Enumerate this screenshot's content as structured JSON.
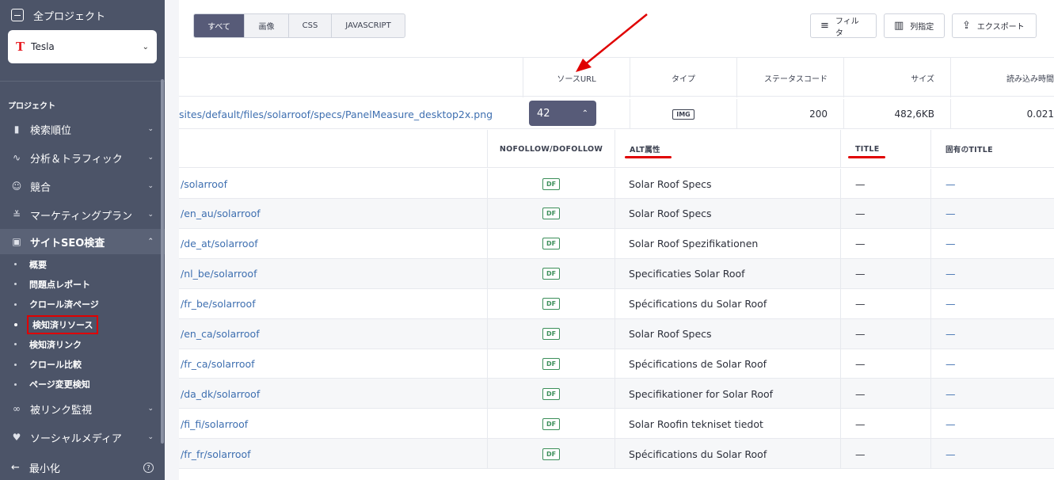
{
  "sidebar": {
    "all_projects": "全プロジェクト",
    "project_name": "Tesla",
    "project_logo": "T",
    "section_label": "プロジェクト",
    "nav": [
      {
        "label": "検索順位",
        "icon": "bar-chart-icon"
      },
      {
        "label": "分析＆トラフィック",
        "icon": "pulse-icon"
      },
      {
        "label": "競合",
        "icon": "users-icon"
      },
      {
        "label": "マーケティングプラン",
        "icon": "checklist-icon"
      },
      {
        "label": "サイトSEO検査",
        "icon": "search-doc-icon"
      }
    ],
    "sub": [
      {
        "label": "概要"
      },
      {
        "label": "問題点レポート"
      },
      {
        "label": "クロール済ページ"
      },
      {
        "label": "検知済リソース"
      },
      {
        "label": "検知済リンク"
      },
      {
        "label": "クロール比較"
      },
      {
        "label": "ページ変更検知"
      }
    ],
    "nav2": [
      {
        "label": "被リンク監視",
        "icon": "link-icon"
      },
      {
        "label": "ソーシャルメディア",
        "icon": "thumbs-up-icon"
      }
    ],
    "minimize": "最小化"
  },
  "toolbar": {
    "segments": [
      "すべて",
      "画像",
      "CSS",
      "JAVASCRIPT"
    ],
    "filter": "フィルタ",
    "columns": "列指定",
    "export": "エクスポート"
  },
  "table": {
    "headers": {
      "source_url": "ソースURL",
      "type": "タイプ",
      "status": "ステータスコード",
      "size": "サイズ",
      "load_time": "読み込み時間"
    },
    "main_row": {
      "url": "sites/default/files/solarroof/specs/PanelMeasure_desktop2x.png",
      "count": "42",
      "type": "IMG",
      "status": "200",
      "size": "482,6KB",
      "load_time": "0.021"
    },
    "sub_headers": {
      "nofollow": "NOFOLLOW/DOFOLLOW",
      "alt": "ALT属性",
      "title": "TITLE",
      "own_title": "固有のTITLE"
    },
    "rows": [
      {
        "url": "/solarroof",
        "df": "DF",
        "alt": "Solar Roof Specs",
        "title": "—",
        "own": "—"
      },
      {
        "url": "/en_au/solarroof",
        "df": "DF",
        "alt": "Solar Roof Specs",
        "title": "—",
        "own": "—"
      },
      {
        "url": "/de_at/solarroof",
        "df": "DF",
        "alt": "Solar Roof Spezifikationen",
        "title": "—",
        "own": "—"
      },
      {
        "url": "/nl_be/solarroof",
        "df": "DF",
        "alt": "Specificaties Solar Roof",
        "title": "—",
        "own": "—"
      },
      {
        "url": "/fr_be/solarroof",
        "df": "DF",
        "alt": "Spécifications du Solar Roof",
        "title": "—",
        "own": "—"
      },
      {
        "url": "/en_ca/solarroof",
        "df": "DF",
        "alt": "Solar Roof Specs",
        "title": "—",
        "own": "—"
      },
      {
        "url": "/fr_ca/solarroof",
        "df": "DF",
        "alt": "Spécifications de Solar Roof",
        "title": "—",
        "own": "—"
      },
      {
        "url": "/da_dk/solarroof",
        "df": "DF",
        "alt": "Specifikationer for Solar Roof",
        "title": "—",
        "own": "—"
      },
      {
        "url": "/fi_fi/solarroof",
        "df": "DF",
        "alt": "Solar Roofin tekniset tiedot",
        "title": "—",
        "own": "—"
      },
      {
        "url": "/fr_fr/solarroof",
        "df": "DF",
        "alt": "Spécifications du Solar Roof",
        "title": "—",
        "own": "—"
      }
    ]
  },
  "colors": {
    "sidebar_bg": "#4c5468",
    "accent": "#575b78",
    "link": "#3e6fb0",
    "annotation_red": "#e00000",
    "df_green": "#3c8f5a"
  }
}
